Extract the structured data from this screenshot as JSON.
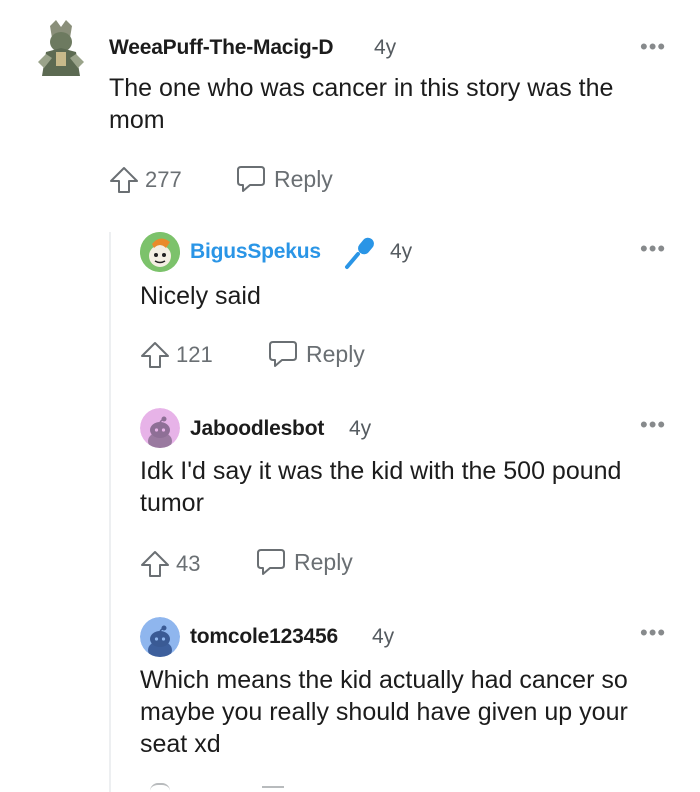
{
  "comments": [
    {
      "username": "WeeaPuff-The-Macig-D",
      "age": "4y",
      "text": "The one who was cancer in this story was the mom",
      "votes": "277",
      "reply_label": "Reply",
      "more_label": "•••",
      "username_color": "#1c1c1c"
    },
    {
      "username": "BigusSpekus",
      "age": "4y",
      "text": "Nicely said",
      "votes": "121",
      "reply_label": "Reply",
      "more_label": "•••",
      "username_color": "#2a95e6",
      "badge_icon": "microphone-icon"
    },
    {
      "username": "Jaboodlesbot",
      "age": "4y",
      "text": "Idk I'd say it was the kid with the 500 pound tumor",
      "votes": "43",
      "reply_label": "Reply",
      "more_label": "•••",
      "username_color": "#1c1c1c"
    },
    {
      "username": "tomcole123456",
      "age": "4y",
      "text": "Which means the kid actually had cancer so maybe you really should have given up your seat xd",
      "more_label": "•••",
      "username_color": "#1c1c1c"
    }
  ],
  "colors": {
    "muted": "#6a6f73",
    "thread_line": "#edeff1",
    "avatar_pink": "#e7b3e8",
    "avatar_blue": "#8fb6ee",
    "avatar_green": "#7cc26b"
  }
}
